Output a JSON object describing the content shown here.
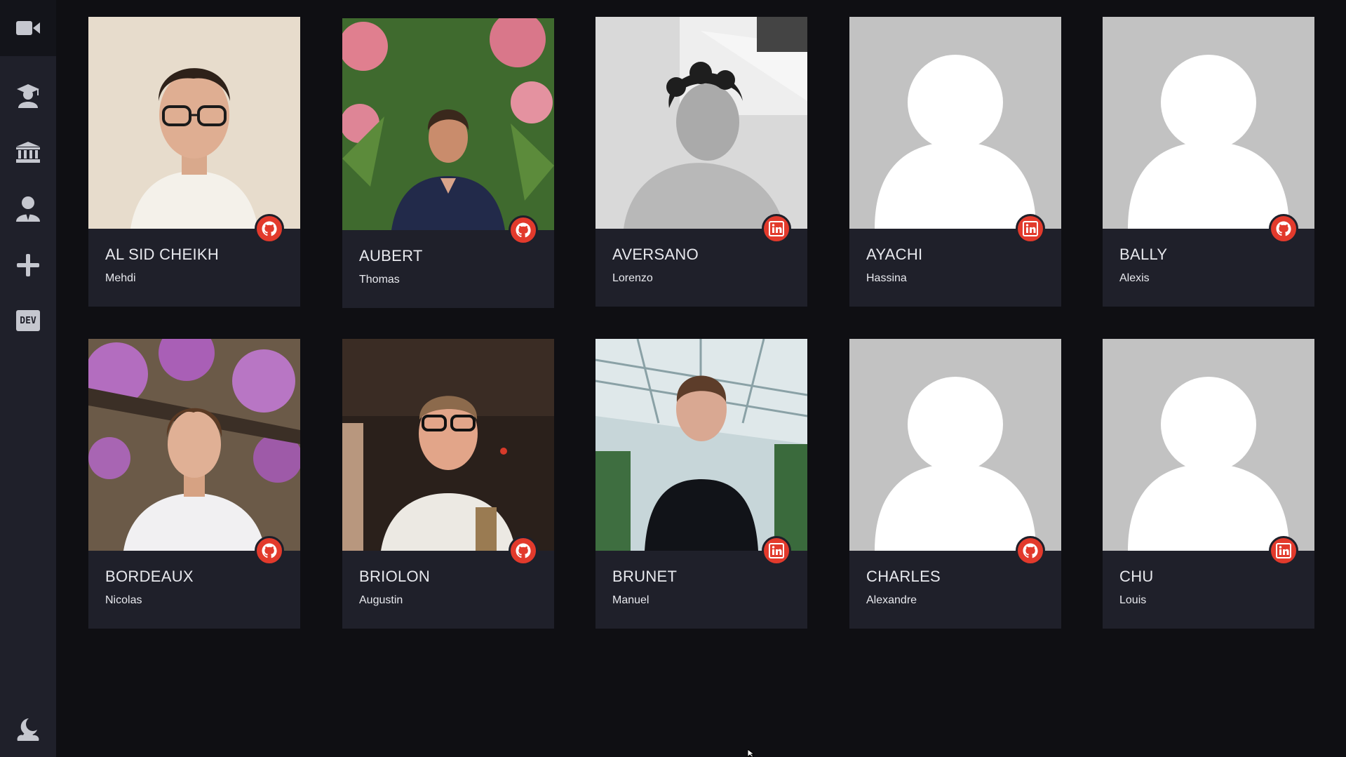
{
  "sidebar": {
    "items": [
      {
        "icon": "video-camera-icon"
      },
      {
        "icon": "graduate-icon"
      },
      {
        "icon": "institution-icon"
      },
      {
        "icon": "user-tie-icon"
      },
      {
        "icon": "plus-icon"
      },
      {
        "icon": "dev-icon",
        "label": "DEV"
      },
      {
        "icon": "moon-cloud-icon"
      }
    ]
  },
  "colors": {
    "background": "#0f0f13",
    "card": "#1f202a",
    "accent": "#e23a2c",
    "placeholder": "#c2c2c2"
  },
  "students": [
    {
      "last": "AL SID CHEIKH",
      "first": "Mehdi",
      "social": "github",
      "photo": "photo"
    },
    {
      "last": "AUBERT",
      "first": "Thomas",
      "social": "github",
      "photo": "photo"
    },
    {
      "last": "AVERSANO",
      "first": "Lorenzo",
      "social": "linkedin",
      "photo": "photo"
    },
    {
      "last": "AYACHI",
      "first": "Hassina",
      "social": "linkedin",
      "photo": "placeholder"
    },
    {
      "last": "BALLY",
      "first": "Alexis",
      "social": "github",
      "photo": "placeholder"
    },
    {
      "last": "BORDEAUX",
      "first": "Nicolas",
      "social": "github",
      "photo": "photo"
    },
    {
      "last": "BRIOLON",
      "first": "Augustin",
      "social": "github",
      "photo": "photo"
    },
    {
      "last": "BRUNET",
      "first": "Manuel",
      "social": "linkedin",
      "photo": "photo"
    },
    {
      "last": "CHARLES",
      "first": "Alexandre",
      "social": "github",
      "photo": "placeholder"
    },
    {
      "last": "CHU",
      "first": "Louis",
      "social": "linkedin",
      "photo": "placeholder"
    }
  ]
}
